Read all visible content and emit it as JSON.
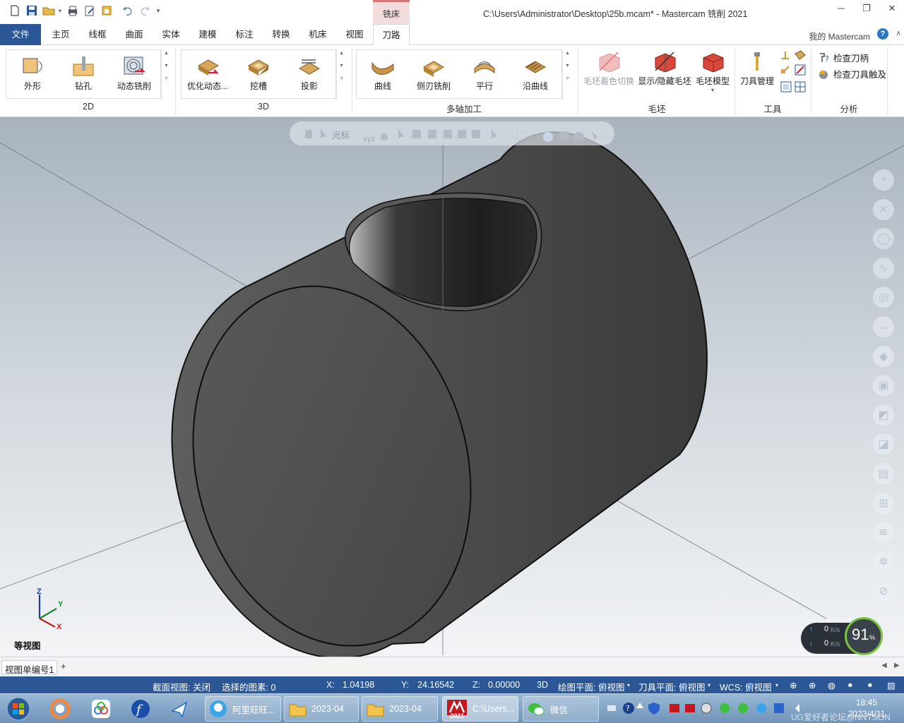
{
  "window": {
    "title": "C:\\Users\\Administrator\\Desktop\\25b.mcam* - Mastercam 铣削 2021",
    "context_tab_header": "铣床",
    "my_mastercam": "我的 Mastercam"
  },
  "tabs": [
    "文件",
    "主页",
    "线框",
    "曲面",
    "实体",
    "建模",
    "标注",
    "转换",
    "机床",
    "视图",
    "刀路"
  ],
  "ribbon": {
    "group_2d": {
      "label": "2D",
      "buttons": [
        "外形",
        "钻孔",
        "动态铣削"
      ]
    },
    "group_3d": {
      "label": "3D",
      "buttons": [
        "优化动态...",
        "挖槽",
        "投影"
      ]
    },
    "group_multiaxis": {
      "label": "多轴加工",
      "buttons": [
        "曲线",
        "侧刃铣削",
        "平行",
        "沿曲线"
      ]
    },
    "group_stock": {
      "label": "毛坯",
      "buttons": [
        "毛坯着色切换",
        "显示/隐藏毛坯",
        "毛坯模型"
      ]
    },
    "group_tools": {
      "label": "工具",
      "buttons": [
        "刀具管理"
      ]
    },
    "group_analysis": {
      "label": "分析",
      "buttons": [
        "检查刀柄",
        "检查刀具触及"
      ]
    }
  },
  "viewport": {
    "toolbar_cursor_label": "光标",
    "axis_z": "Z",
    "axis_y": "Y",
    "axis_x": "X",
    "view_name": "等视图",
    "net_up": "0",
    "net_down": "0",
    "net_unit": "K/s",
    "gauge_value": "91",
    "gauge_unit": "%"
  },
  "viewsheet": {
    "label": "视图单编号1",
    "add": "+"
  },
  "status": {
    "section_view": "截面视图: 关闭",
    "selected": "选择的图素: 0",
    "x_label": "X:",
    "x_value": "1.04198",
    "y_label": "Y:",
    "y_value": "24.16542",
    "z_label": "Z:",
    "z_value": "0.00000",
    "mode": "3D",
    "cplane": "绘图平面: 俯视图",
    "tplane": "刀具平面: 俯视图",
    "wcs": "WCS: 俯视图"
  },
  "taskbar": {
    "tasks": [
      "阿里旺旺...",
      "2023-04",
      "2023-04",
      "C:\\Users...",
      "微信"
    ],
    "mastercam_badge": "2021",
    "time": "18:45",
    "date": "2023/4/11",
    "watermark": "UG爱好者论坛@NNTSON"
  }
}
